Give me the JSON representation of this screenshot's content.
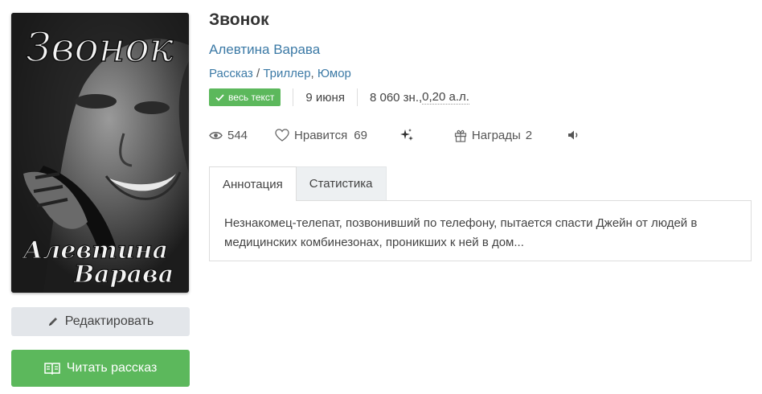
{
  "book": {
    "title": "Звонок",
    "author": "Алевтина Варава",
    "genre_type": "Рассказ",
    "genre_sep": " / ",
    "genre_1": "Триллер",
    "genre_comma": ", ",
    "genre_2": "Юмор"
  },
  "cover": {
    "title_text": "Звонок",
    "author_line1": "Алевтина",
    "author_line2": "Варава"
  },
  "meta": {
    "badge": "весь текст",
    "date": "9 июня",
    "size_prefix": "8 060 зн., ",
    "size_al": "0,20 а.л."
  },
  "stats": {
    "views": "544",
    "likes_label": "Нравится",
    "likes_count": "69",
    "awards_label": "Награды",
    "awards_count": "2"
  },
  "tabs": [
    {
      "label": "Аннотация",
      "active": true
    },
    {
      "label": "Статистика",
      "active": false
    }
  ],
  "annotation": "Незнакомец-телепат, позвонивший по телефону, пытается спасти Джейн от людей в медицинских комбинезонах, проникших к ней в дом...",
  "buttons": {
    "edit": "Редактировать",
    "read": "Читать рассказ"
  },
  "colors": {
    "link": "#3c7aa6",
    "green": "#5cb85c",
    "edit_bg": "#e3e6ea"
  },
  "icons": [
    "check-icon",
    "eye-icon",
    "heart-icon",
    "sparkle-icon",
    "gift-icon",
    "speaker-icon",
    "pencil-icon",
    "book-icon"
  ]
}
